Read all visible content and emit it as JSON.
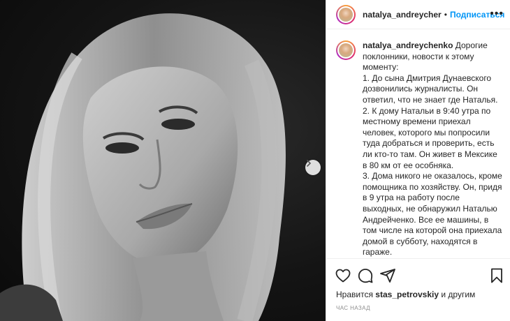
{
  "post": {
    "username": "natalya_andreycher",
    "separator": "•",
    "follow_label": "Подписаться",
    "more_icon": "more-horizontal-icon"
  },
  "caption": {
    "username": "natalya_andreychenko",
    "text": " Дорогие поклонники, новости к этому моменту:\n1. До сына Дмитрия Дунаевского дозвонились журналисты. Он ответил, что не знает где Наталья.\n2. К дому Натальи в 9:40 утра по местному времени приехал человек, которого мы попросили туда добраться и проверить, есть ли кто-то там. Он живет в Мексике в 80 км от ее особняка.\n3. Дома никого не оказалось, кроме помощника по хозяйству. Он, придя в 9 утра на работу после выходных, не обнаружил Наталью Андрейченко. Все ее машины, в том числе на которой она приехала домой в субботу, находятся в гараже."
  },
  "actions": {
    "icons": [
      "heart-icon",
      "comment-icon",
      "share-icon",
      "bookmark-icon"
    ]
  },
  "likes": {
    "prefix": "Нравится ",
    "user": "stas_petrovskiy",
    "suffix": " и другим"
  },
  "timestamp": "ЧАС НАЗАД",
  "colors": {
    "follow_blue": "#0095f6",
    "text": "#262626",
    "muted": "#8e8e8e",
    "border": "#efefef"
  }
}
